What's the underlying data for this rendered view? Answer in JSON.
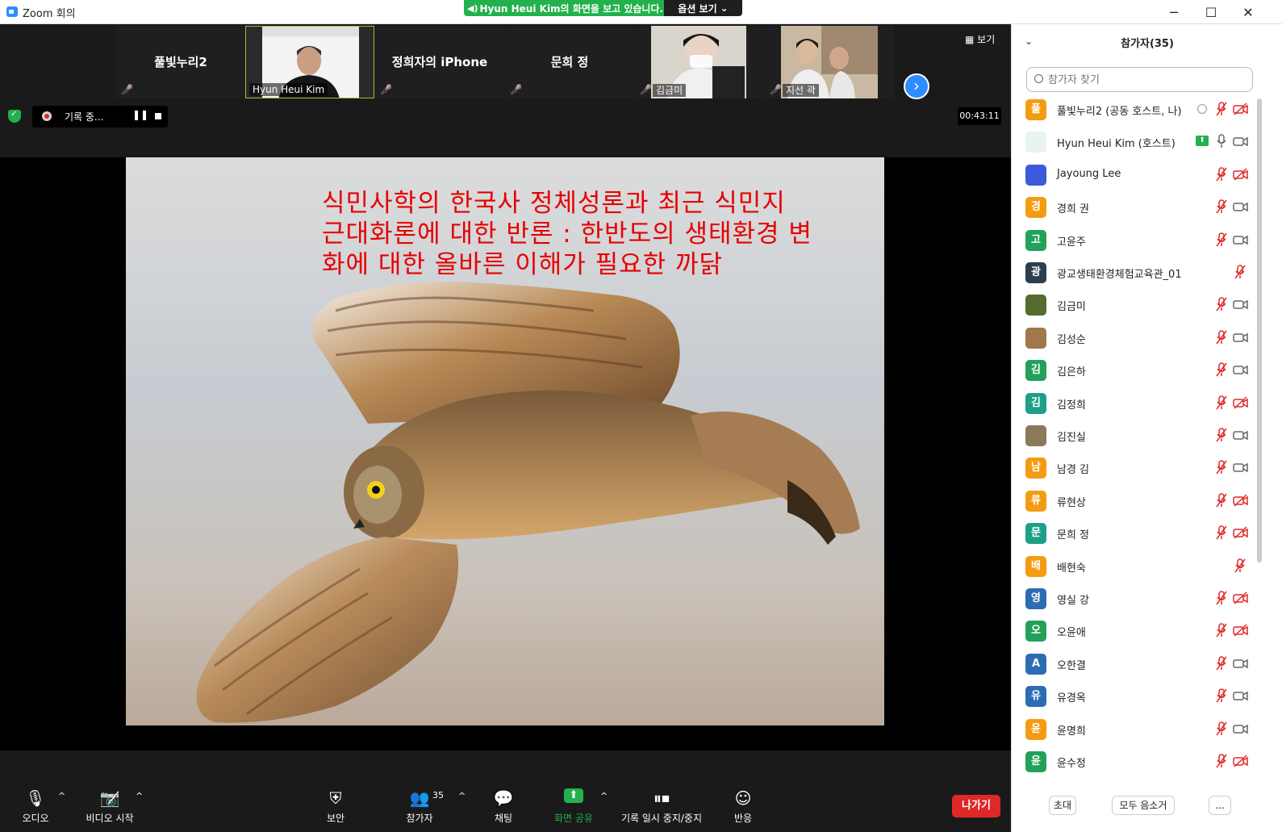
{
  "window": {
    "title": "Zoom 회의"
  },
  "share_banner": {
    "text": "Hyun Heui Kim의 화면을 보고 있습니다.",
    "options_label": "옵션 보기"
  },
  "video_strip": {
    "tiles": [
      {
        "name": "풀빛누리2",
        "has_video": false,
        "muted": true
      },
      {
        "name": "Hyun Heui Kim",
        "has_video": true,
        "muted": false,
        "active": true
      },
      {
        "name": "정희자의 iPhone",
        "has_video": false,
        "muted": true
      },
      {
        "name": "문희 정",
        "has_video": false,
        "muted": true
      },
      {
        "name": "김금미",
        "has_video": true,
        "muted": true
      },
      {
        "name": "지선 곽",
        "has_video": true,
        "muted": true
      }
    ],
    "view_label": "보기"
  },
  "recording": {
    "label": "기록 중..."
  },
  "timer": "00:43:11",
  "slide": {
    "title_lines": [
      "식민사학의 한국사 정체성론과 최근 식민지",
      "근대화론에 대한 반론 : 한반도의 생태환경 변",
      "화에 대한 올바른 이해가 필요한 까닭"
    ]
  },
  "toolbar": {
    "audio": "오디오",
    "video": "비디오 시작",
    "security": "보안",
    "participants": "참가자",
    "participants_count": "35",
    "chat": "채팅",
    "share": "화면 공유",
    "record": "기록 일시 중지/중지",
    "reactions": "반응",
    "leave": "나가기"
  },
  "panel": {
    "title": "참가자(35)",
    "search_placeholder": "참가자 찾기",
    "participants": [
      {
        "name": "풀빛누리2 (공동 호스트, 나)",
        "avatar_text": "풀",
        "avatar_color": "#f39c12",
        "mic": "muted",
        "cam": "off"
      },
      {
        "name": "Hyun Heui Kim (호스트)",
        "avatar_text": "",
        "avatar_color": "#e8f3ee",
        "mic": "on",
        "cam": "on"
      },
      {
        "name": "Jayoung Lee",
        "avatar_text": "",
        "avatar_color": "#3b5bdb",
        "mic": "muted",
        "cam": "off"
      },
      {
        "name": "경희 권",
        "avatar_text": "경",
        "avatar_color": "#f39c12",
        "mic": "muted",
        "cam": "on"
      },
      {
        "name": "고윤주",
        "avatar_text": "고",
        "avatar_color": "#23a15a",
        "mic": "muted",
        "cam": "on"
      },
      {
        "name": "광교생태환경체험교육관_01",
        "avatar_text": "광",
        "avatar_color": "#2c3e50",
        "mic": "muted",
        "cam": "none"
      },
      {
        "name": "김금미",
        "avatar_text": "",
        "avatar_color": "#556b2f",
        "mic": "muted",
        "cam": "on"
      },
      {
        "name": "김성순",
        "avatar_text": "",
        "avatar_color": "#a0784a",
        "mic": "muted",
        "cam": "on"
      },
      {
        "name": "김은하",
        "avatar_text": "김",
        "avatar_color": "#23a15a",
        "mic": "muted",
        "cam": "on"
      },
      {
        "name": "김정희",
        "avatar_text": "김",
        "avatar_color": "#1e9f88",
        "mic": "muted",
        "cam": "off"
      },
      {
        "name": "김진실",
        "avatar_text": "",
        "avatar_color": "#8a7a5a",
        "mic": "muted",
        "cam": "on"
      },
      {
        "name": "남경 김",
        "avatar_text": "남",
        "avatar_color": "#f39c12",
        "mic": "muted",
        "cam": "on"
      },
      {
        "name": "류현상",
        "avatar_text": "류",
        "avatar_color": "#f39c12",
        "mic": "muted",
        "cam": "off"
      },
      {
        "name": "문희 정",
        "avatar_text": "문",
        "avatar_color": "#1e9f88",
        "mic": "muted",
        "cam": "off"
      },
      {
        "name": "배현숙",
        "avatar_text": "배",
        "avatar_color": "#f39c12",
        "mic": "muted",
        "cam": "none"
      },
      {
        "name": "영실 강",
        "avatar_text": "영",
        "avatar_color": "#2d6cb5",
        "mic": "muted",
        "cam": "off"
      },
      {
        "name": "오윤애",
        "avatar_text": "오",
        "avatar_color": "#23a15a",
        "mic": "muted",
        "cam": "off"
      },
      {
        "name": "오한결",
        "avatar_text": "A",
        "avatar_color": "#2d6cb5",
        "mic": "muted",
        "cam": "on"
      },
      {
        "name": "유경옥",
        "avatar_text": "유",
        "avatar_color": "#2d6cb5",
        "mic": "muted",
        "cam": "on"
      },
      {
        "name": "윤명희",
        "avatar_text": "윤",
        "avatar_color": "#f39c12",
        "mic": "muted",
        "cam": "on"
      },
      {
        "name": "윤수정",
        "avatar_text": "윤",
        "avatar_color": "#23a15a",
        "mic": "muted",
        "cam": "off"
      }
    ],
    "footer": {
      "invite": "초대",
      "mute_all": "모두 음소거",
      "more": "..."
    }
  },
  "colors": {
    "accent": "#2d8cff",
    "share_green": "#22b14c",
    "leave_red": "#e02828",
    "mute_red": "#e02828"
  }
}
